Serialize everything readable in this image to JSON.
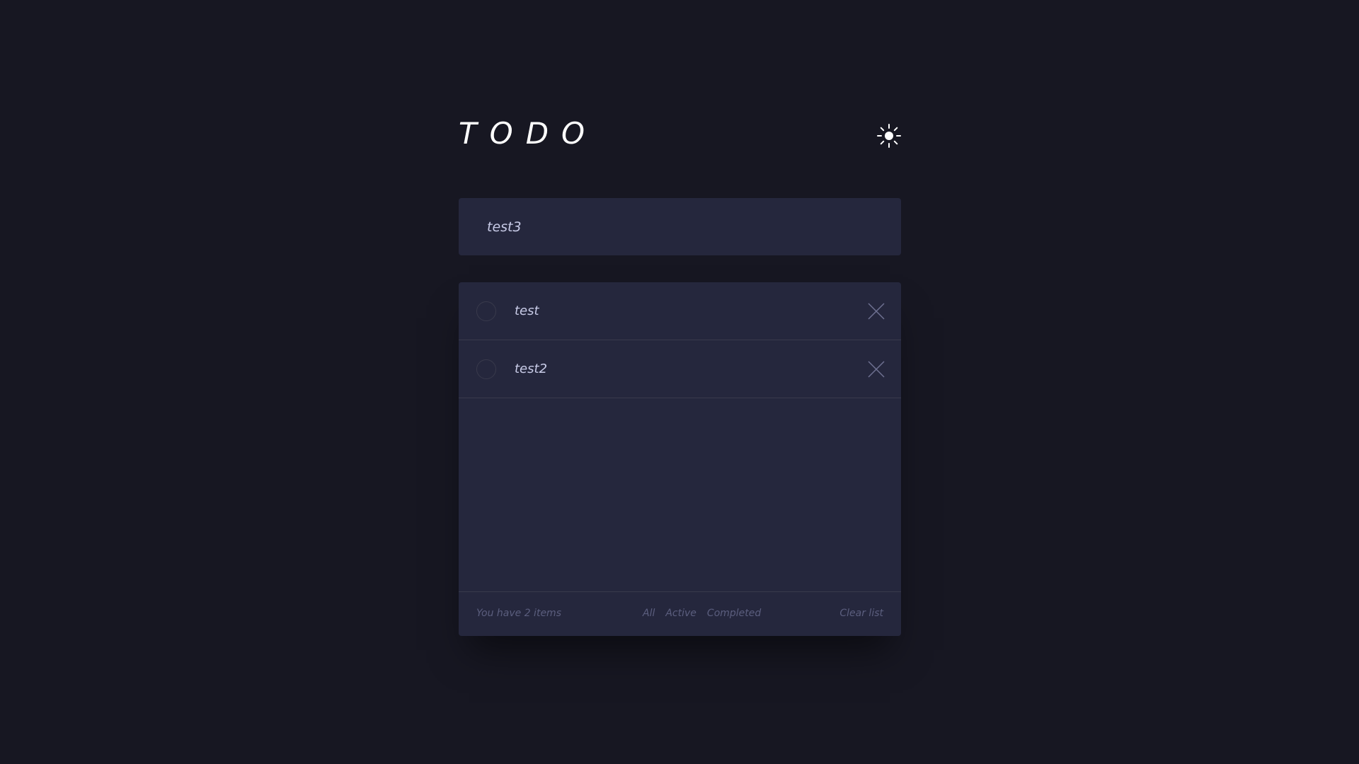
{
  "header": {
    "title": "TODO",
    "theme_icon": "sun-icon"
  },
  "new_todo": {
    "value": "test3",
    "placeholder": ""
  },
  "todos": [
    {
      "text": "test",
      "completed": false
    },
    {
      "text": "test2",
      "completed": false
    }
  ],
  "footer": {
    "items_left": "You have 2 items",
    "filters": [
      "All",
      "Active",
      "Completed"
    ],
    "clear_label": "Clear list"
  },
  "colors": {
    "background": "#171722",
    "card": "#25273d",
    "text": "#c8cbe7",
    "muted": "#5b5e7e",
    "border": "#393a4c"
  }
}
